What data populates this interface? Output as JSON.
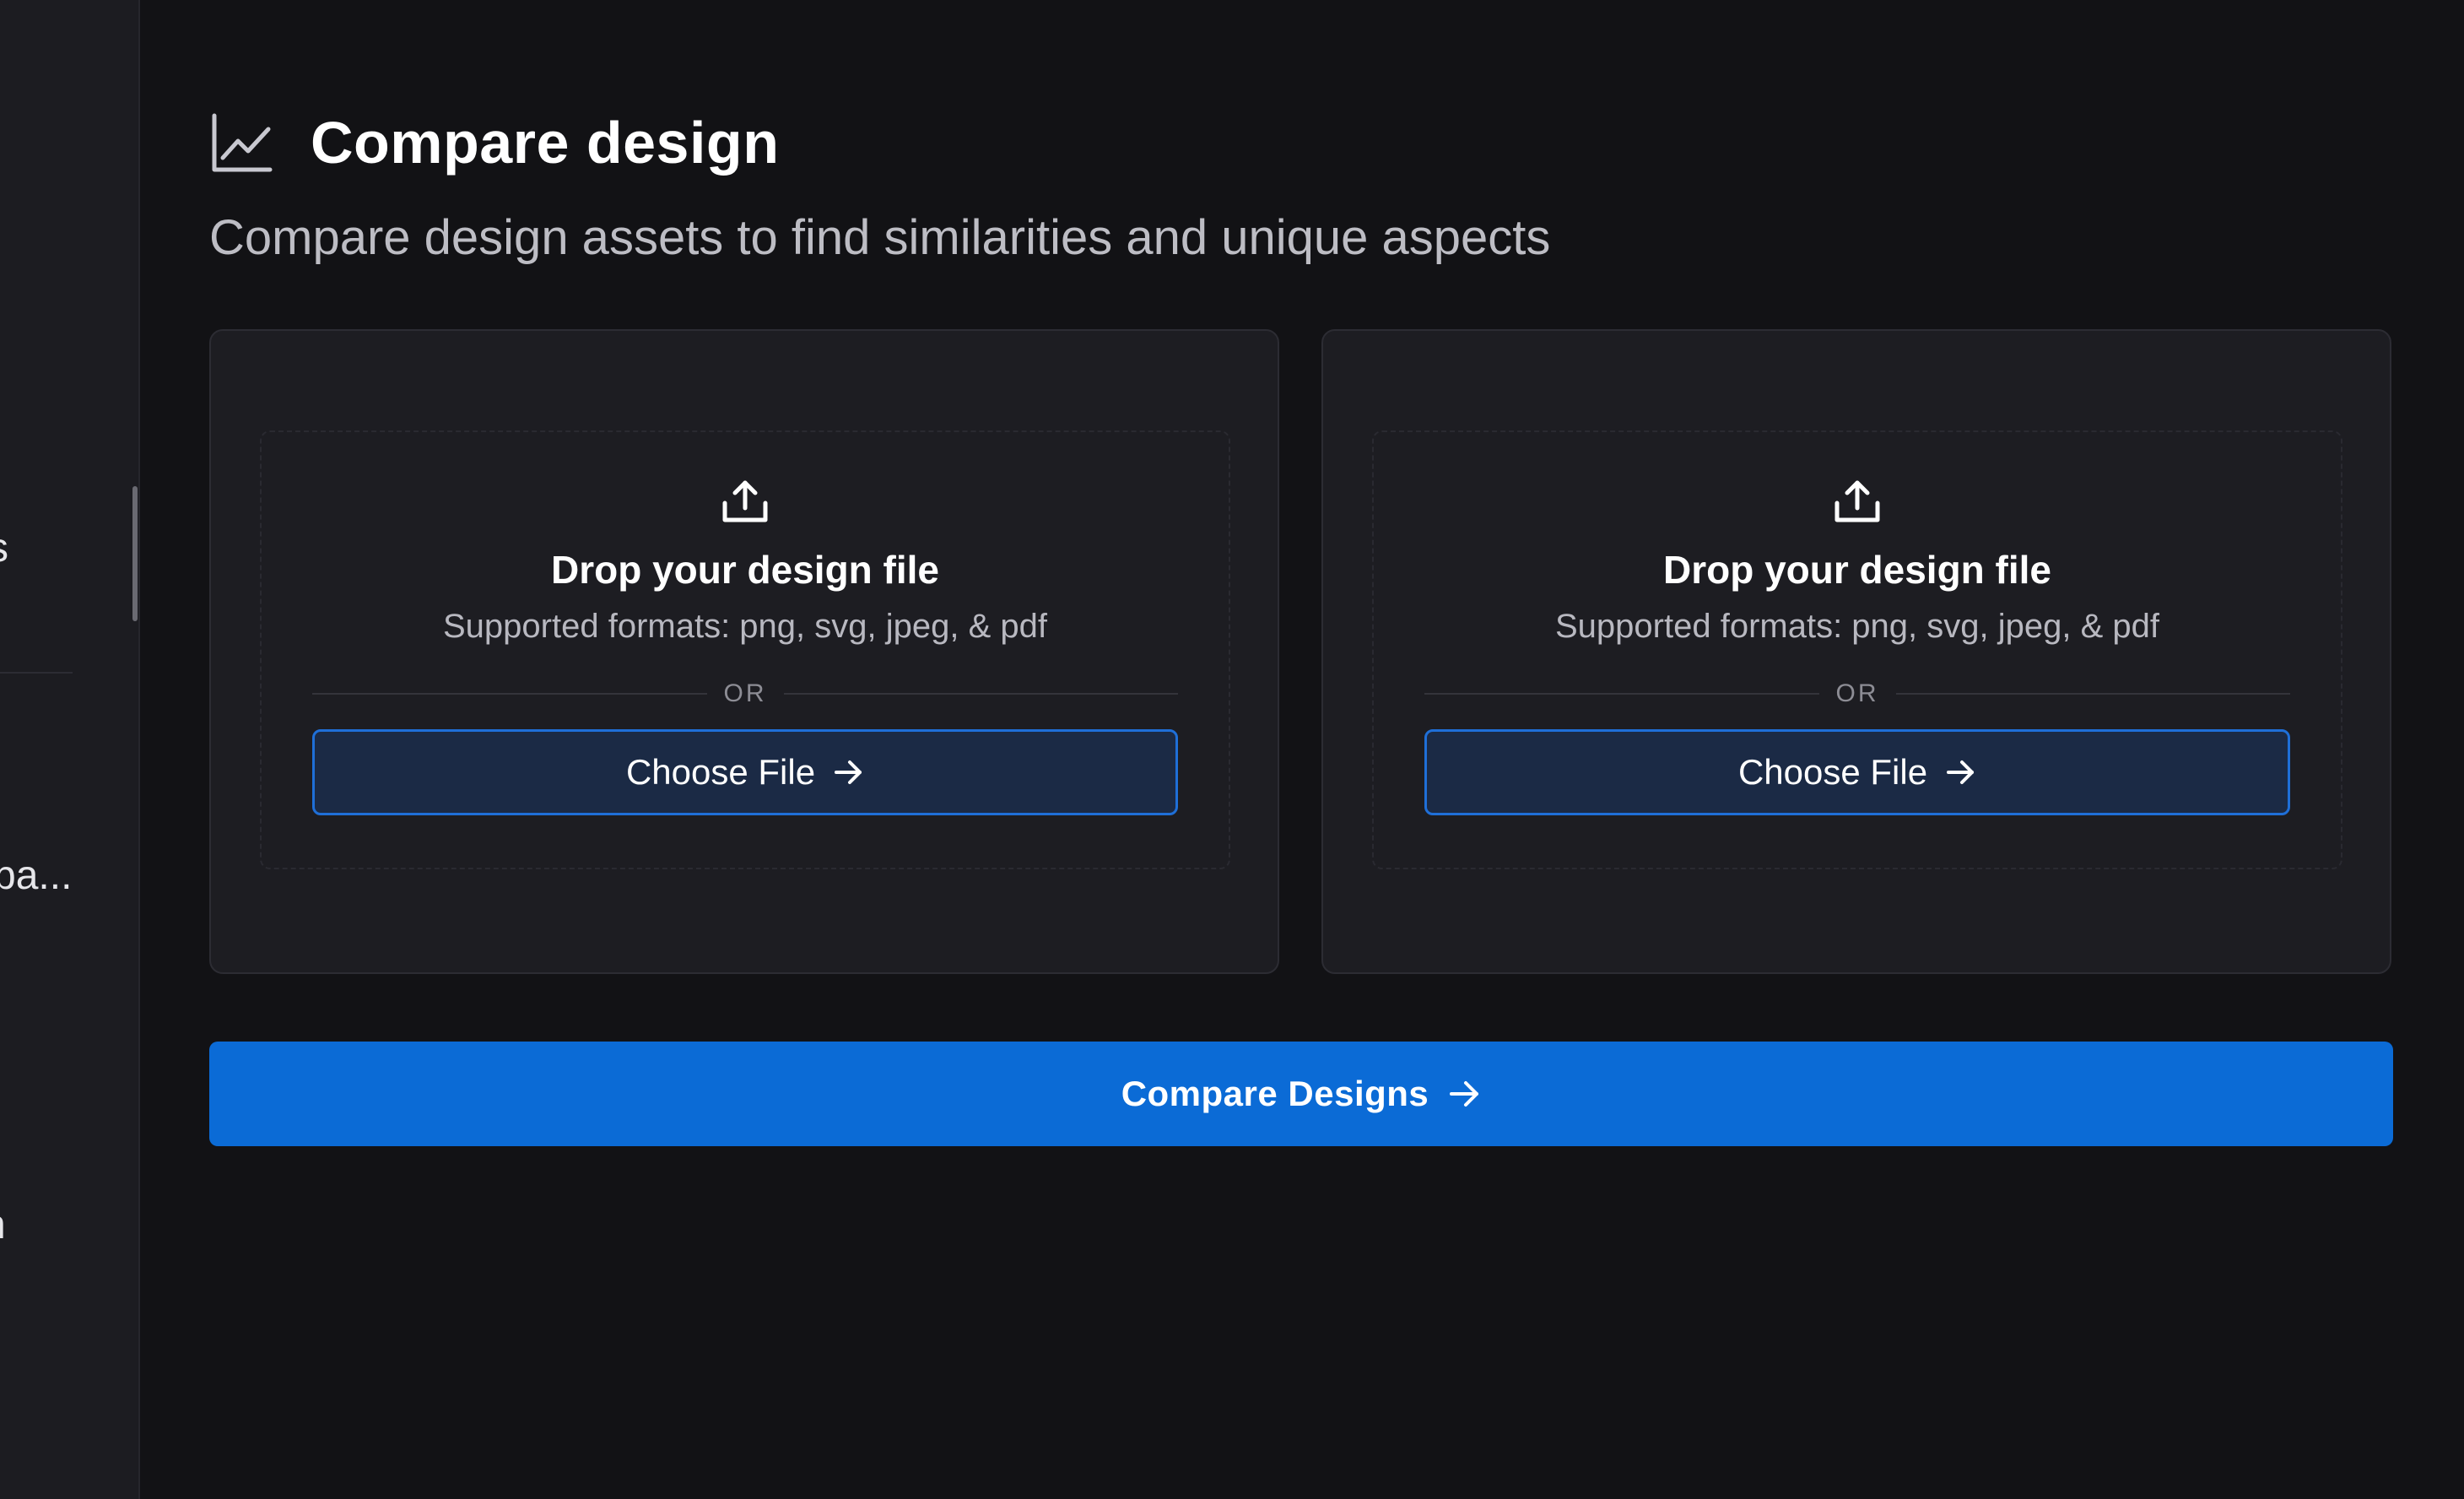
{
  "sidebar": {
    "fragments": [
      "s",
      "pa...",
      "n"
    ]
  },
  "header": {
    "icon": "line-chart-icon",
    "title": "Compare design",
    "subtitle": "Compare design assets to find similarities and unique aspects"
  },
  "upload_cards": [
    {
      "icon": "upload-icon",
      "title": "Drop your design file",
      "formats": "Supported formats: png, svg, jpeg, & pdf",
      "divider": "OR",
      "button_label": "Choose File"
    },
    {
      "icon": "upload-icon",
      "title": "Drop your design file",
      "formats": "Supported formats: png, svg, jpeg, & pdf",
      "divider": "OR",
      "button_label": "Choose File"
    }
  ],
  "compare": {
    "button_label": "Compare Designs"
  },
  "colors": {
    "background": "#121215",
    "sidebar": "#1c1c21",
    "card": "#1d1d22",
    "accent": "#0b6bd6",
    "choose_button_bg": "#1b2a45",
    "choose_button_border": "#1f6fd8"
  }
}
